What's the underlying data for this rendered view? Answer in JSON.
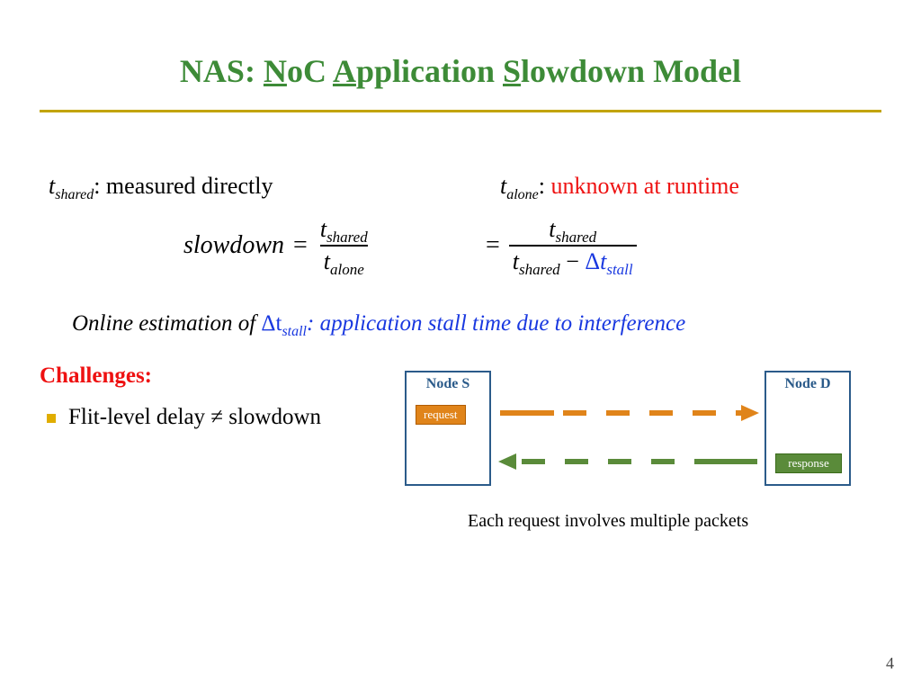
{
  "title": {
    "prefix": "NAS: ",
    "N": "N",
    "noc_rest": "oC ",
    "A": "A",
    "app_rest": "pplication ",
    "S": "S",
    "slow_rest": "lowdown Model"
  },
  "line1": {
    "var": "t",
    "sub": "shared",
    "after": ": measured directly"
  },
  "line2": {
    "var": "t",
    "sub": "alone",
    "after": ": ",
    "red": "unknown at runtime"
  },
  "equation": {
    "lhs": "slowdown",
    "eq": "=",
    "frac1_num_t": "t",
    "frac1_num_sub": "shared",
    "frac1_den_t": "t",
    "frac1_den_sub": "alone",
    "eq2": "=",
    "frac2_num_t": "t",
    "frac2_num_sub": "shared",
    "frac2_den_t1": "t",
    "frac2_den_sub1": "shared",
    "minus": " − ",
    "delta": "Δ",
    "dt_t": "t",
    "dt_sub": "stall"
  },
  "estimation": {
    "pre": "Online estimation of ",
    "deltaT": "Δt",
    "sub": "stall",
    "post": ": application stall time due to interference"
  },
  "challenges": "Challenges:",
  "bullet1": "Flit-level delay ≠ slowdown",
  "diagram": {
    "nodeS": "Node S",
    "nodeD": "Node D",
    "request": "request",
    "response": "response"
  },
  "caption": "Each request involves multiple packets",
  "pagenum": "4"
}
